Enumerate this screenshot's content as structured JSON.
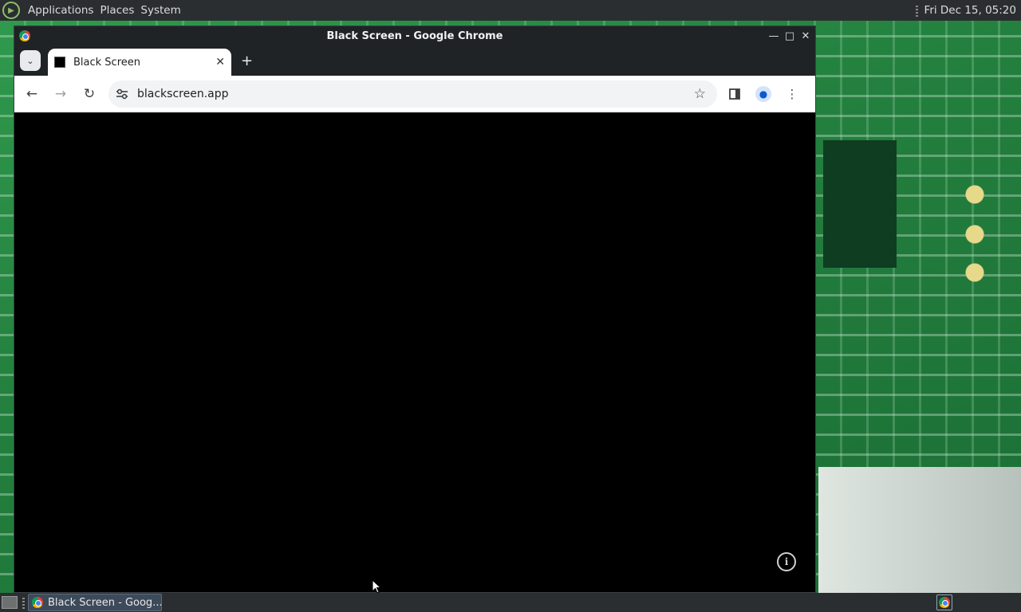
{
  "top_panel": {
    "menus": [
      "Applications",
      "Places",
      "System"
    ],
    "clock": "Fri Dec 15, 05:20"
  },
  "window": {
    "title": "Black Screen - Google Chrome",
    "controls": {
      "minimize_icon": "minimize-icon",
      "maximize_icon": "maximize-icon",
      "close_icon": "close-icon"
    }
  },
  "tabs": [
    {
      "label": "Black Screen",
      "active": true
    }
  ],
  "omnibox": {
    "url": "blackscreen.app"
  },
  "icons": {
    "back": "←",
    "forward": "→",
    "reload": "↻",
    "star": "☆",
    "menu": "⋮",
    "new_tab": "+",
    "tab_close": "✕",
    "info": "i"
  },
  "page": {
    "background_color": "#000000"
  },
  "taskbar": {
    "tasks": [
      {
        "label": "Black Screen - Goog..."
      }
    ]
  }
}
